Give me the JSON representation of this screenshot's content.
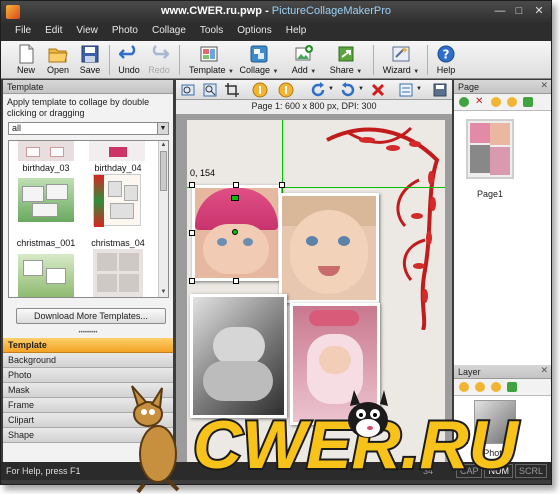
{
  "window": {
    "title_site": "www.CWER.ru",
    "title_file": ".pwp",
    "title_sep": " - ",
    "title_app": "PictureCollageMakerPro"
  },
  "menu": [
    "File",
    "Edit",
    "View",
    "Photo",
    "Collage",
    "Tools",
    "Options",
    "Help"
  ],
  "toolbar": {
    "new": "New",
    "open": "Open",
    "save": "Save",
    "undo": "Undo",
    "redo": "Redo",
    "template": "Template",
    "collage": "Collage",
    "add": "Add",
    "share": "Share",
    "wizard": "Wizard",
    "help": "Help"
  },
  "template_panel": {
    "title": "Template",
    "instructions": "Apply template to collage by double clicking or dragging",
    "filter": "all",
    "thumbnails": [
      {
        "label": "birthday_03"
      },
      {
        "label": "birthday_04"
      },
      {
        "label": "christmas_001"
      },
      {
        "label": "christmas_04"
      }
    ],
    "download_button": "Download More Templates..."
  },
  "accordion": [
    "Template",
    "Background",
    "Photo",
    "Mask",
    "Frame",
    "Clipart",
    "Shape"
  ],
  "canvas": {
    "page_info": "Page 1: 600 x 800 px, DPI: 300",
    "coordinate_readout": "0, 154"
  },
  "page_panel": {
    "title": "Page",
    "pages": [
      {
        "label": "Page1"
      }
    ]
  },
  "layer_panel": {
    "title": "Layer",
    "partial_label": "Photo"
  },
  "statusbar": {
    "help_text": "For Help, press F1",
    "num_fragment": "34",
    "indicators": [
      "CAP",
      "NUM",
      "SCRL"
    ]
  },
  "watermark": {
    "text": "CWER.RU"
  },
  "colors": {
    "accent_orange": "#f3a225",
    "dark_chrome": "#2d2d2d",
    "selection_green": "#00c000",
    "ornament_red": "#c21b1b"
  }
}
